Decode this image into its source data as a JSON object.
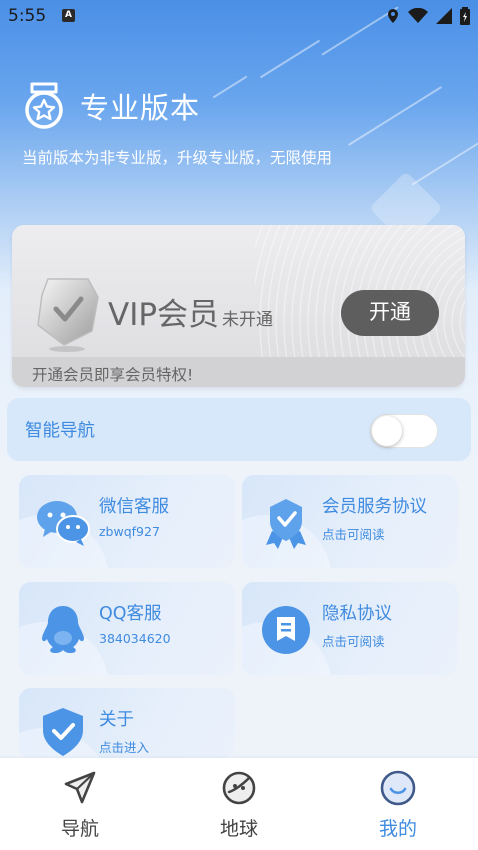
{
  "status_bar": {
    "time": "5:55",
    "notification_icon": "A",
    "icons": [
      "location-icon",
      "wifi-icon",
      "signal-icon",
      "battery-icon"
    ]
  },
  "header": {
    "title": "专业版本",
    "subtitle": "当前版本为非专业版，升级专业版，无限使用"
  },
  "vip": {
    "label": "VIP会员",
    "status": "未开通",
    "button_label": "开通",
    "footer": "开通会员即享会员特权!"
  },
  "smart_nav": {
    "label": "智能导航",
    "enabled": false
  },
  "tiles": [
    {
      "title": "微信客服",
      "subtitle": "zbwqf927",
      "icon": "wechat-icon"
    },
    {
      "title": "会员服务协议",
      "subtitle": "点击可阅读",
      "icon": "badge-icon"
    },
    {
      "title": "QQ客服",
      "subtitle": "384034620",
      "icon": "qq-icon"
    },
    {
      "title": "隐私协议",
      "subtitle": "点击可阅读",
      "icon": "document-icon"
    },
    {
      "title": "关于",
      "subtitle": "点击进入",
      "icon": "shield-check-icon"
    }
  ],
  "bottom_nav": [
    {
      "label": "导航",
      "icon": "navigation-arrow-icon",
      "active": false
    },
    {
      "label": "地球",
      "icon": "planet-icon",
      "active": false
    },
    {
      "label": "我的",
      "icon": "profile-face-icon",
      "active": true
    }
  ],
  "colors": {
    "accent": "#3f8be0",
    "header_blue": "#4a8fe6",
    "vip_button": "#5e5e5e",
    "inactive_nav": "#444444"
  }
}
